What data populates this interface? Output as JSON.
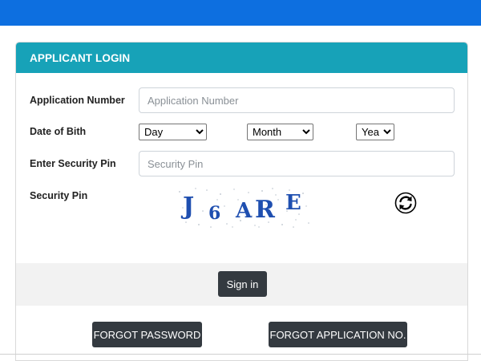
{
  "header": {
    "title": "APPLICANT LOGIN"
  },
  "form": {
    "application_number": {
      "label": "Application Number",
      "placeholder": "Application Number",
      "value": ""
    },
    "dob": {
      "label": "Date of Bith",
      "day": {
        "selected": "Day"
      },
      "month": {
        "selected": "Month"
      },
      "year": {
        "selected": "Year"
      }
    },
    "security_pin": {
      "label": "Enter Security Pin",
      "placeholder": "Security Pin",
      "value": ""
    },
    "captcha": {
      "label": "Security Pin",
      "text": "J6ARE",
      "refresh_icon": "refresh-icon"
    }
  },
  "actions": {
    "signin_label": "Sign in",
    "forgot_password_label": "FORGOT PASSWORD",
    "forgot_app_label": "FORGOT APPLICATION NO."
  },
  "colors": {
    "topbar": "#0d6fe0",
    "header": "#17a2b8",
    "button": "#343a40",
    "captcha_text": "#1f4fb0"
  }
}
